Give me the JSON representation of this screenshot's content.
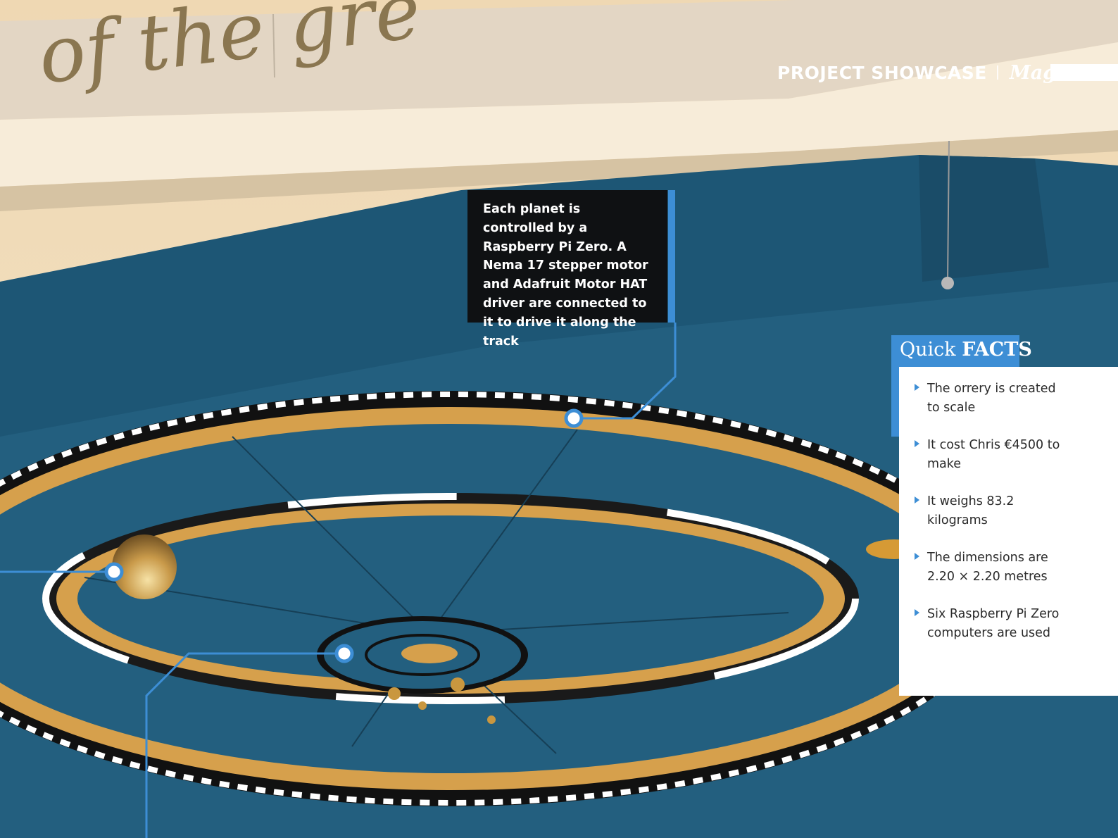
{
  "header": {
    "section": "PROJECT SHOWCASE",
    "brand": "MagPi"
  },
  "photo": {
    "wall_text": "of the gre"
  },
  "caption": {
    "text": "Each planet is controlled by a Raspberry Pi Zero. A Nema 17 stepper motor and Adafruit Motor HAT driver are connected to it to drive it along the track"
  },
  "quick_facts": {
    "title_light": "Quick",
    "title_bold": "FACTS",
    "items": [
      "The orrery is created to scale",
      "It cost Chris €4500 to make",
      "It weighs 83.2 kilograms",
      "The dimensions are 2.20 × 2.20 metres",
      "Six Raspberry Pi Zero computers are used"
    ]
  },
  "colors": {
    "accent": "#3d8ed5",
    "board_blue": "#1f5a78",
    "ring_gold": "#d6a04c",
    "caption_bg": "#0f1113"
  }
}
